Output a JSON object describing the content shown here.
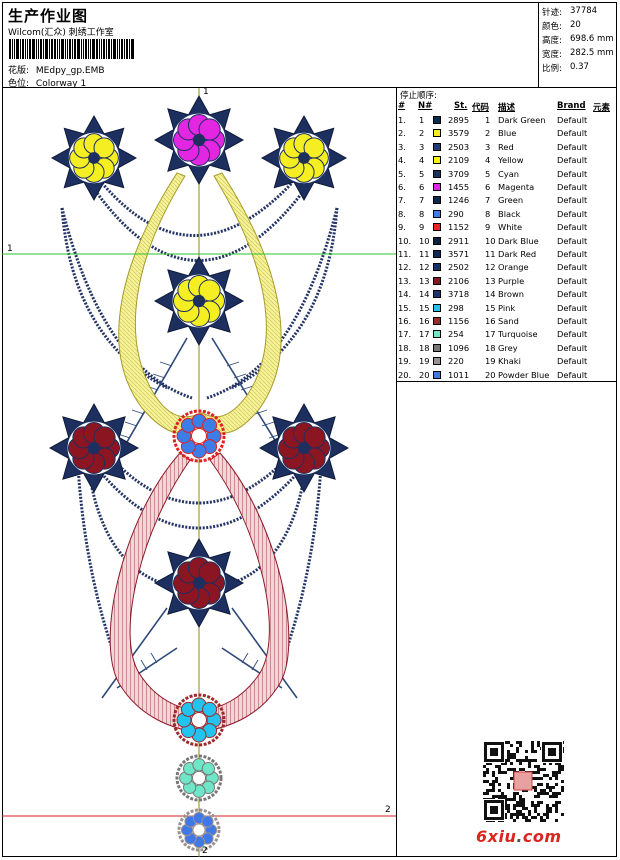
{
  "header": {
    "title": "生产作业图",
    "studio": "Wilcom(汇众) 刺绣工作室",
    "design_label": "花版:",
    "design_value": "MEdpy_gp.EMB",
    "colorway_label": "色位:",
    "colorway_value": "Colorway 1"
  },
  "stats": {
    "stitches_label": "针迹:",
    "stitches_value": "37784",
    "colors_label": "颜色:",
    "colors_value": "20",
    "height_label": "高度:",
    "height_value": "698.6 mm",
    "width_label": "宽度:",
    "width_value": "282.5 mm",
    "scale_label": "比例:",
    "scale_value": "0.37"
  },
  "guides": {
    "v_top": "1",
    "h_mid": "1",
    "h_bottom": "2",
    "v_bottom": "2"
  },
  "sequence": {
    "caption": "停止顺序:",
    "headers": {
      "num": "#",
      "n": "N#",
      "st": "St.",
      "code": "代码",
      "desc": "描述",
      "brand": "Brand",
      "elem": "元素"
    },
    "rows": [
      {
        "num": "1.",
        "n": "1",
        "st": "2895",
        "code": "1",
        "desc": "Dark Green",
        "brand": "Default",
        "color": "#0b2a52"
      },
      {
        "num": "2.",
        "n": "2",
        "st": "3579",
        "code": "2",
        "desc": "Blue",
        "brand": "Default",
        "color": "#f5ee1c"
      },
      {
        "num": "3.",
        "n": "3",
        "st": "2503",
        "code": "3",
        "desc": "Red",
        "brand": "Default",
        "color": "#1e3a7a"
      },
      {
        "num": "4.",
        "n": "4",
        "st": "2109",
        "code": "4",
        "desc": "Yellow",
        "brand": "Default",
        "color": "#f8f21c"
      },
      {
        "num": "5.",
        "n": "5",
        "st": "3709",
        "code": "5",
        "desc": "Cyan",
        "brand": "Default",
        "color": "#17335f"
      },
      {
        "num": "6.",
        "n": "6",
        "st": "1455",
        "code": "6",
        "desc": "Magenta",
        "brand": "Default",
        "color": "#e226e2"
      },
      {
        "num": "7.",
        "n": "7",
        "st": "1246",
        "code": "7",
        "desc": "Green",
        "brand": "Default",
        "color": "#102650"
      },
      {
        "num": "8.",
        "n": "8",
        "st": "290",
        "code": "8",
        "desc": "Black",
        "brand": "Default",
        "color": "#3d7de8"
      },
      {
        "num": "9.",
        "n": "9",
        "st": "1152",
        "code": "9",
        "desc": "White",
        "brand": "Default",
        "color": "#ee2222"
      },
      {
        "num": "10.",
        "n": "10",
        "st": "2911",
        "code": "10",
        "desc": "Dark Blue",
        "brand": "Default",
        "color": "#0b2042"
      },
      {
        "num": "11.",
        "n": "11",
        "st": "3571",
        "code": "11",
        "desc": "Dark Red",
        "brand": "Default",
        "color": "#0f2a5a"
      },
      {
        "num": "12.",
        "n": "12",
        "st": "2502",
        "code": "12",
        "desc": "Orange",
        "brand": "Default",
        "color": "#15306a"
      },
      {
        "num": "13.",
        "n": "13",
        "st": "2106",
        "code": "13",
        "desc": "Purple",
        "brand": "Default",
        "color": "#8c1522"
      },
      {
        "num": "14.",
        "n": "14",
        "st": "3718",
        "code": "14",
        "desc": "Brown",
        "brand": "Default",
        "color": "#1a3570"
      },
      {
        "num": "15.",
        "n": "15",
        "st": "298",
        "code": "15",
        "desc": "Pink",
        "brand": "Default",
        "color": "#22c3ef"
      },
      {
        "num": "16.",
        "n": "16",
        "st": "1156",
        "code": "16",
        "desc": "Sand",
        "brand": "Default",
        "color": "#9c2a2a"
      },
      {
        "num": "17.",
        "n": "17",
        "st": "254",
        "code": "17",
        "desc": "Turquoise",
        "brand": "Default",
        "color": "#6fe6c8"
      },
      {
        "num": "18.",
        "n": "18",
        "st": "1096",
        "code": "18",
        "desc": "Grey",
        "brand": "Default",
        "color": "#777777"
      },
      {
        "num": "19.",
        "n": "19",
        "st": "220",
        "code": "19",
        "desc": "Khaki",
        "brand": "Default",
        "color": "#9a9090"
      },
      {
        "num": "20.",
        "n": "20",
        "st": "1011",
        "code": "20",
        "desc": "Powder Blue",
        "brand": "Default",
        "color": "#3f78e8"
      }
    ]
  },
  "footer": {
    "logo_main": "6xiu",
    "logo_dot": ".",
    "logo_tld": "com"
  }
}
